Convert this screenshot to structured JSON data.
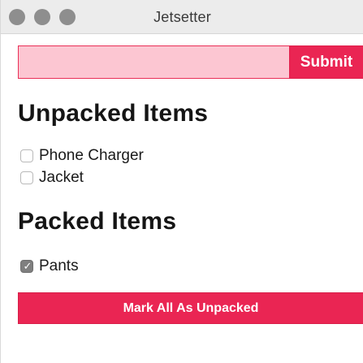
{
  "window": {
    "title": "Jetsetter"
  },
  "form": {
    "input_value": "",
    "input_placeholder": "",
    "submit_label": "Submit"
  },
  "unpacked": {
    "heading": "Unpacked Items",
    "items": [
      {
        "label": "Phone Charger",
        "checked": false
      },
      {
        "label": "Jacket",
        "checked": false
      }
    ]
  },
  "packed": {
    "heading": "Packed Items",
    "items": [
      {
        "label": "Pants",
        "checked": true
      }
    ]
  },
  "actions": {
    "mark_all_label": "Mark All As Unpacked"
  },
  "colors": {
    "accent": "#ea2553",
    "input_bg": "#fcc6d2",
    "checkbox_checked": "#7f7f7f"
  },
  "icons": {
    "checked": "checkmark-icon"
  }
}
